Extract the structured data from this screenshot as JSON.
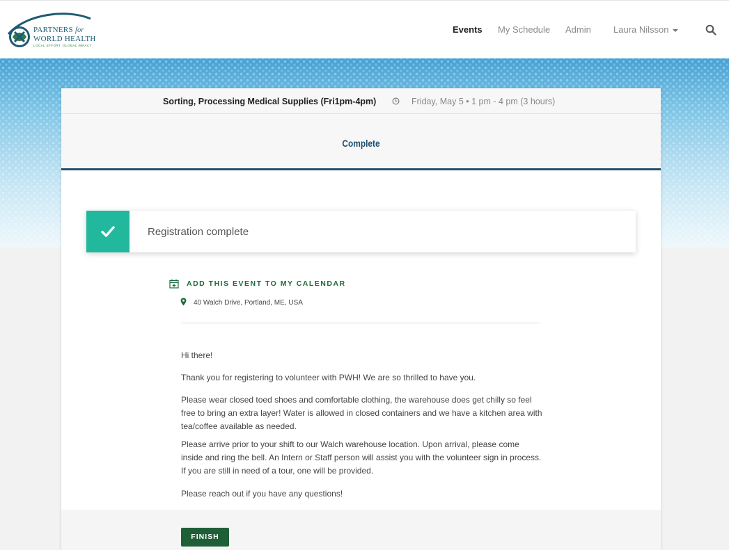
{
  "brand": {
    "line1": "PARTNERS",
    "line1_suffix": "for",
    "line2": "WORLD HEALTH",
    "tagline": "LOCAL EFFORT. GLOBAL IMPACT",
    "logo_icon": "globe-logo-icon"
  },
  "nav": {
    "items": [
      {
        "label": "Events",
        "active": true
      },
      {
        "label": "My Schedule",
        "active": false
      },
      {
        "label": "Admin",
        "active": false
      }
    ],
    "user": "Laura Nilsson",
    "search_icon": "search-icon"
  },
  "event": {
    "title": "Sorting, Processing Medical Supplies (Fri1pm-4pm)",
    "datetime": "Friday, May 5 • 1 pm - 4 pm (3 hours)",
    "clock_icon": "clock-icon"
  },
  "step": {
    "label": "Complete"
  },
  "alert": {
    "message": "Registration complete",
    "icon": "check-icon",
    "badge_color": "#22b89d"
  },
  "calendar": {
    "link_text": "ADD THIS EVENT TO MY CALENDAR",
    "icon": "calendar-plus-icon"
  },
  "location": {
    "address": "40 Walch Drive, Portland, ME, USA",
    "icon": "map-pin-icon"
  },
  "message": {
    "greeting": "Hi there!",
    "p1": "Thank you for registering to volunteer with PWH! We are so thrilled to have you.",
    "p2": "Please wear closed toed shoes and comfortable clothing, the warehouse does get chilly so feel free to bring an extra layer! Water is allowed in closed containers and we have a kitchen area with tea/coffee available as needed.",
    "p3": "Please arrive prior to your shift to our Walch warehouse location. Upon arrival, please come inside and ring the bell. An Intern or Staff person will assist you with the volunteer sign in process. If you are still in need of a tour, one will be provided.",
    "p4": "Please reach out if you have any questions!"
  },
  "actions": {
    "finish_label": "FINISH"
  },
  "colors": {
    "primary": "#1f4f6f",
    "brand_green": "#1f5f37",
    "link_green": "#1d6a3c",
    "success": "#22b89d"
  }
}
